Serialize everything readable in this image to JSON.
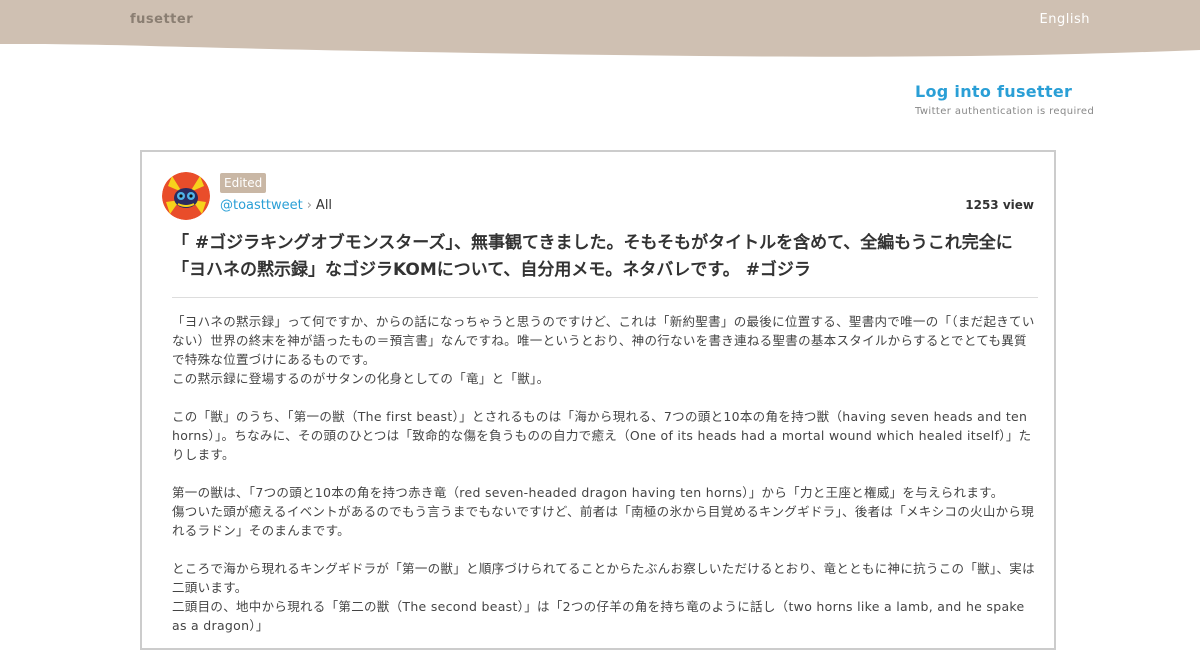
{
  "header": {
    "brand": "fusetter",
    "language": "English",
    "colors": {
      "band": "#cfc0b2",
      "brand_text": "#8a7e72"
    }
  },
  "login": {
    "link_label": "Log into fusetter",
    "note": "Twitter authentication is required",
    "link_color": "#2a9fd6"
  },
  "post": {
    "badge": "Edited",
    "username": "@toasttweet",
    "separator": "›",
    "scope": "All",
    "views": "1253 view",
    "title": "「 #ゴジラキングオブモンスターズ」、無事観てきました。そもそもがタイトルを含めて、全編もうこれ完全に「ヨハネの黙示録」なゴジラKOMについて、自分用メモ。ネタバレです。 #ゴジラ",
    "paragraphs": [
      "「ヨハネの黙示録」って何ですか、からの話になっちゃうと思うのですけど、これは「新約聖書」の最後に位置する、聖書内で唯一の「（まだ起きていない）世界の終末を神が語ったもの＝預言書」なんですね。唯一というとおり、神の行ないを書き連ねる聖書の基本スタイルからするとでとても異質で特殊な位置づけにあるものです。",
      "この黙示録に登場するのがサタンの化身としての「竜」と「獣」。",
      "",
      "この「獣」のうち、「第一の獣（The first beast）」とされるものは「海から現れる、7つの頭と10本の角を持つ獣（having seven heads and ten horns）」。ちなみに、その頭のひとつは「致命的な傷を負うものの自力で癒え（One of its heads had a mortal wound which healed itself）」たりします。",
      "",
      "第一の獣は、「7つの頭と10本の角を持つ赤き竜（red seven-headed dragon having ten horns）」から「力と王座と権威」を与えられます。",
      "傷ついた頭が癒えるイベントがあるのでもう言うまでもないですけど、前者は「南極の氷から目覚めるキングギドラ」、後者は「メキシコの火山から現れるラドン」そのまんまです。",
      "",
      "ところで海から現れるキングギドラが「第一の獣」と順序づけられてることからたぶんお察しいただけるとおり、竜とともに神に抗うこの「獣」、実は二頭います。",
      "二頭目の、地中から現れる「第二の獣（The second beast）」は「2つの仔羊の角を持ち竜のように話し（two horns like a lamb, and he spake as a dragon）」"
    ]
  }
}
